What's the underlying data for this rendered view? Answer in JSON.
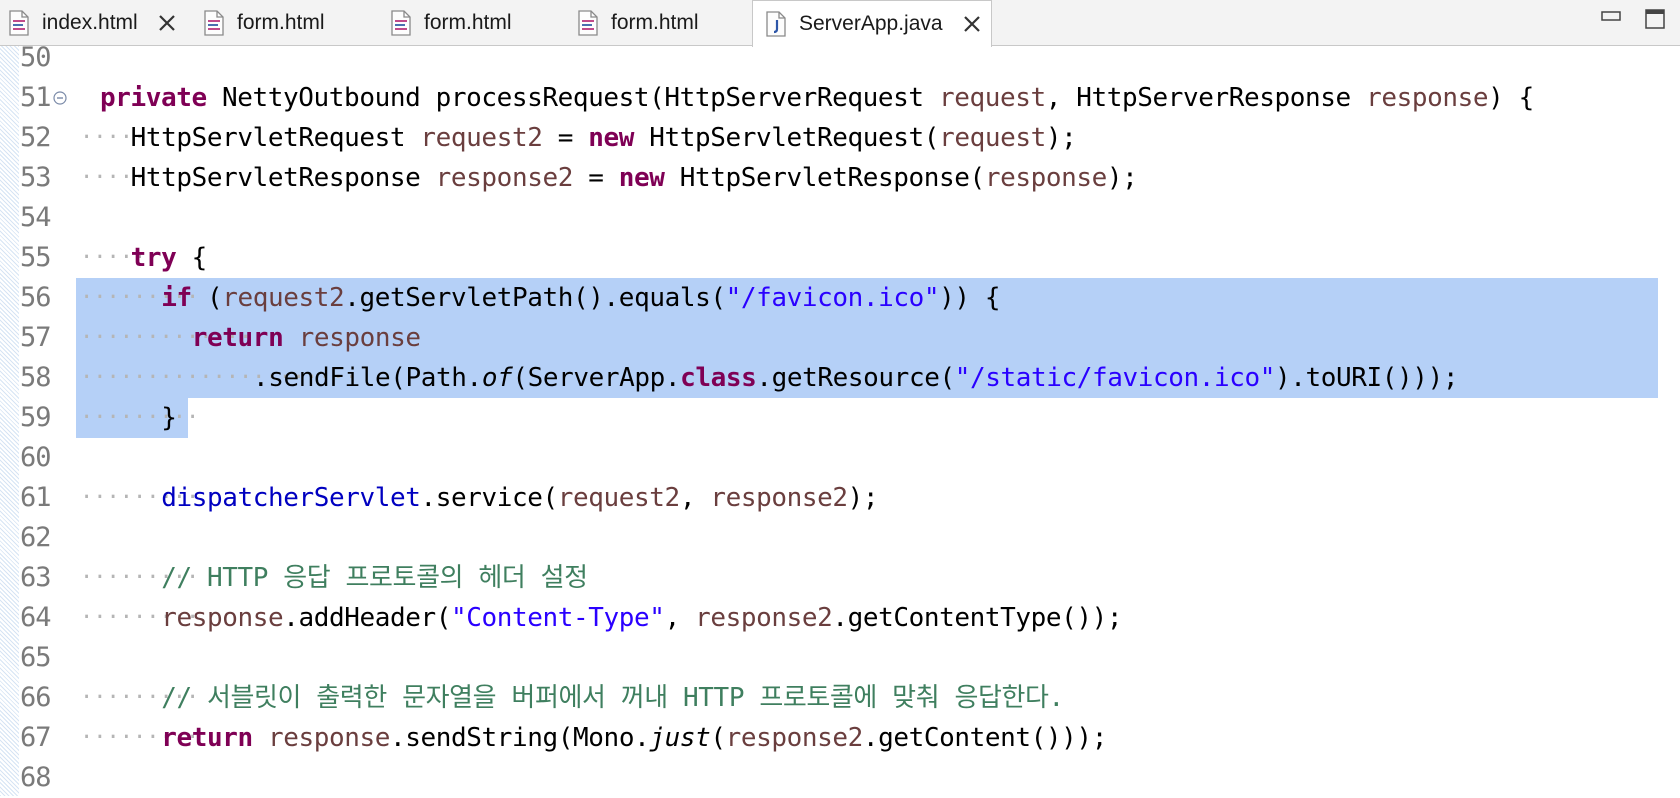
{
  "tabs": [
    {
      "label": "index.html",
      "icon": "html-file-icon",
      "closable": true
    },
    {
      "label": "form.html",
      "icon": "html-file-icon",
      "closable": false
    },
    {
      "label": "form.html",
      "icon": "html-file-icon",
      "closable": false
    },
    {
      "label": "form.html",
      "icon": "html-file-icon",
      "closable": false
    },
    {
      "label": "ServerApp.java",
      "icon": "java-file-icon",
      "closable": true,
      "active": true
    }
  ],
  "colors": {
    "keyword": "#7f0055",
    "variable": "#6a3e3e",
    "field": "#0000c0",
    "string": "#2a00ff",
    "comment": "#3f7f5f",
    "plain": "#000000",
    "selection": "#b5d0f7",
    "line_number": "#7a7a7a"
  },
  "editor": {
    "lines": [
      {
        "number": "50",
        "code": ""
      },
      {
        "number": "51",
        "code": "private NettyOutbound processRequest(HttpServerRequest request, HttpServerResponse response) {",
        "folded_marker": true
      },
      {
        "number": "52",
        "code": "  HttpServletRequest request2 = new HttpServletRequest(request);"
      },
      {
        "number": "53",
        "code": "  HttpServletResponse response2 = new HttpServletResponse(response);"
      },
      {
        "number": "54",
        "code": ""
      },
      {
        "number": "55",
        "code": "  try {"
      },
      {
        "number": "56",
        "code": "    if (request2.getServletPath().equals(\"/favicon.ico\")) {",
        "selected": true
      },
      {
        "number": "57",
        "code": "      return response",
        "selected": true
      },
      {
        "number": "58",
        "code": "          .sendFile(Path.of(ServerApp.class.getResource(\"/static/favicon.ico\").toURI()));",
        "selected": true
      },
      {
        "number": "59",
        "code": "    }",
        "selected": true
      },
      {
        "number": "60",
        "code": ""
      },
      {
        "number": "61",
        "code": "    dispatcherServlet.service(request2, response2);"
      },
      {
        "number": "62",
        "code": ""
      },
      {
        "number": "63",
        "code": "    // HTTP 응답 프로토콜의 헤더 설정"
      },
      {
        "number": "64",
        "code": "    response.addHeader(\"Content-Type\", response2.getContentType());"
      },
      {
        "number": "65",
        "code": ""
      },
      {
        "number": "66",
        "code": "    // 서블릿이 출력한 문자열을 버퍼에서 꺼내 HTTP 프로토콜에 맞춰 응답한다."
      },
      {
        "number": "67",
        "code": "    return response.sendString(Mono.just(response2.getContent()));"
      },
      {
        "number": "68",
        "code": ""
      }
    ]
  }
}
